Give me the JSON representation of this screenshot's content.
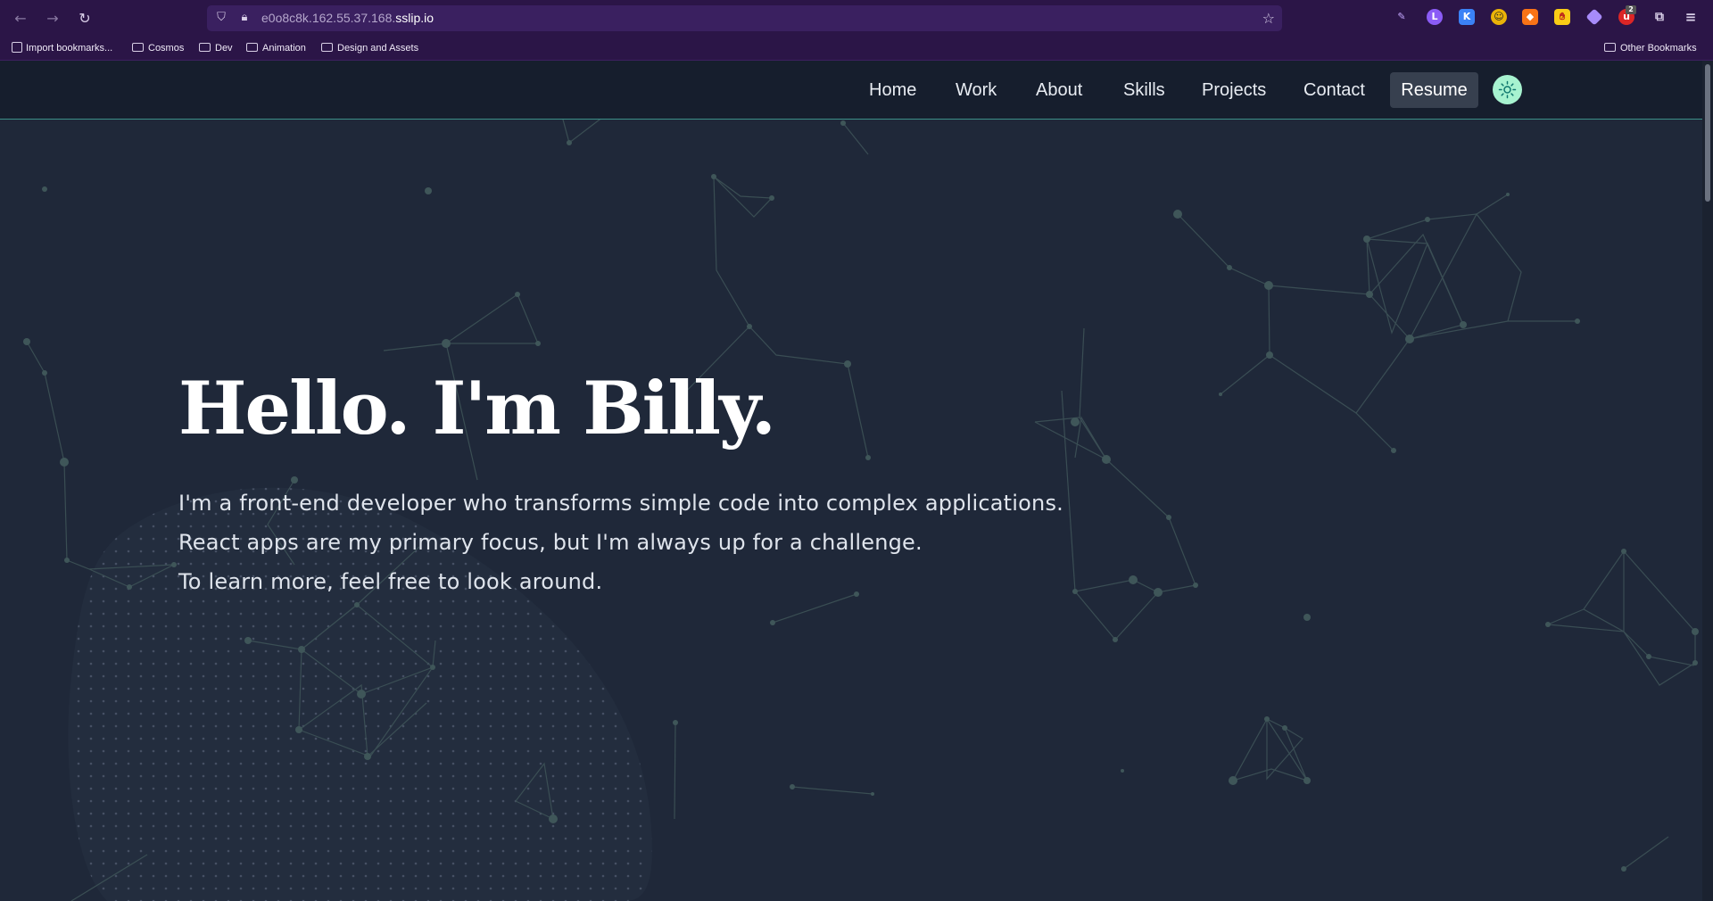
{
  "browser": {
    "url_prefix": "e0o8c8k.162.55.37.168.",
    "url_host": "sslip.io",
    "bookmarks": [
      "Import bookmarks...",
      "Cosmos",
      "Dev",
      "Animation",
      "Design and Assets"
    ],
    "other_bookmarks": "Other Bookmarks",
    "extension_badge": "2"
  },
  "nav": {
    "items": [
      "Home",
      "Work",
      "About",
      "Skills",
      "Projects",
      "Contact"
    ],
    "resume": "Resume"
  },
  "hero": {
    "title": "Hello. I'm Billy.",
    "lines": [
      "I'm a front-end developer who transforms simple code into complex applications.",
      "React apps are my primary focus, but I'm always up for a challenge.",
      "To learn more, feel free to look around."
    ]
  },
  "colors": {
    "accent": "#3b8f88",
    "toggle": "#a7f3d0",
    "background": "#1f2839"
  }
}
